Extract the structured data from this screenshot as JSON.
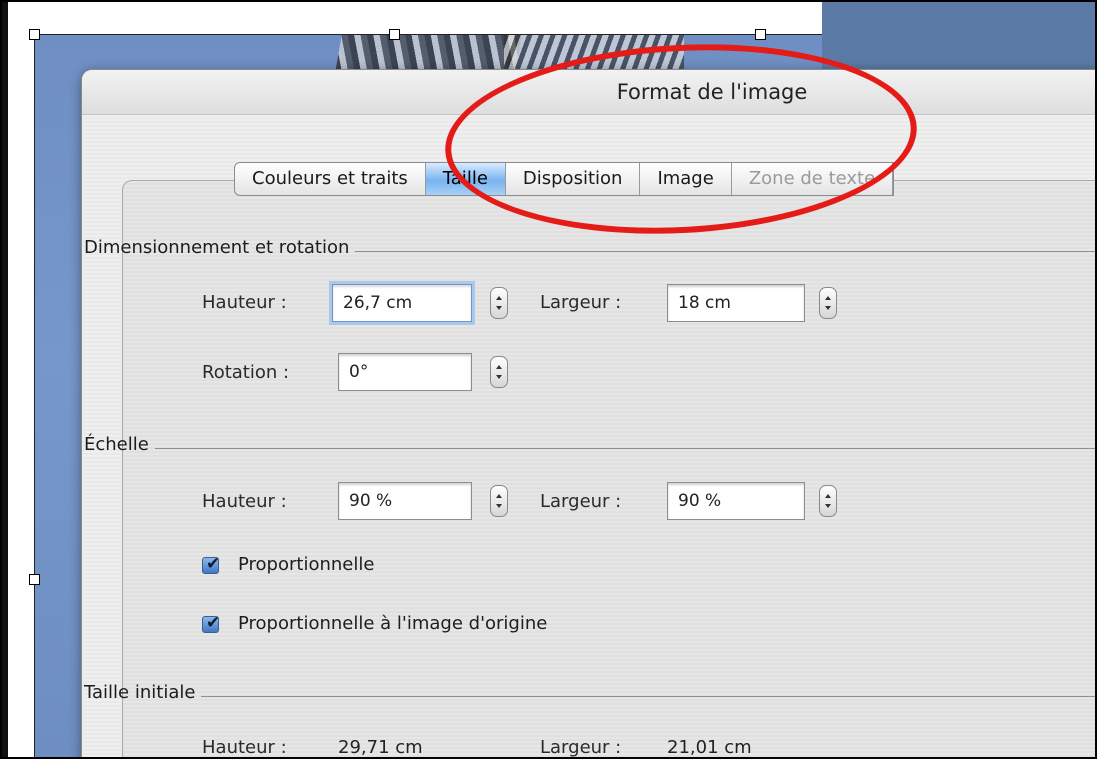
{
  "dialog": {
    "title": "Format de l'image"
  },
  "tabs": [
    {
      "label": "Couleurs et traits",
      "active": false,
      "enabled": true
    },
    {
      "label": "Taille",
      "active": true,
      "enabled": true
    },
    {
      "label": "Disposition",
      "active": false,
      "enabled": true
    },
    {
      "label": "Image",
      "active": false,
      "enabled": true
    },
    {
      "label": "Zone de texte",
      "active": false,
      "enabled": false
    }
  ],
  "sizing": {
    "heading": "Dimensionnement et rotation",
    "height_label": "Hauteur :",
    "height_value": "26,7 cm",
    "width_label": "Largeur :",
    "width_value": "18 cm",
    "rotation_label": "Rotation :",
    "rotation_value": "0°"
  },
  "scale": {
    "heading": "Échelle",
    "height_label": "Hauteur :",
    "height_value": "90 %",
    "width_label": "Largeur :",
    "width_value": "90 %",
    "lock_aspect_label": "Proportionnelle",
    "lock_aspect_checked": true,
    "relative_original_label": "Proportionnelle à l'image d'origine",
    "relative_original_checked": true
  },
  "original": {
    "heading": "Taille initiale",
    "height_label": "Hauteur :",
    "height_value": "29,71 cm",
    "width_label": "Largeur :",
    "width_value": "21,01 cm"
  },
  "colors": {
    "annotation": "#e41b17",
    "active_tab": "#79b3ef",
    "desktop_blue": "#5b7aa6",
    "checkbox_blue": "#3f78c6"
  }
}
